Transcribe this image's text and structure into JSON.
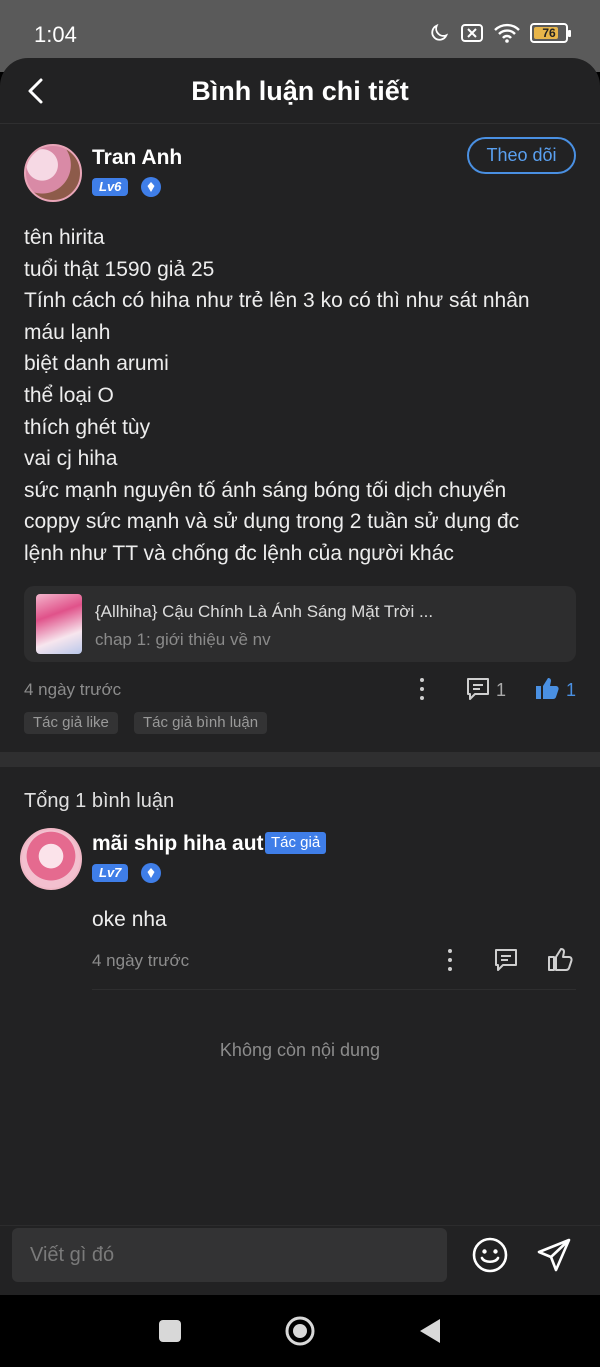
{
  "status_bar": {
    "time": "1:04",
    "battery": "76"
  },
  "header": {
    "title": "Bình luận chi tiết"
  },
  "post": {
    "username": "Tran Anh",
    "level": "Lv6",
    "follow_label": "Theo dõi",
    "lines": [
      "tên hirita",
      "tuổi thật 1590 giả 25",
      "Tính cách có hiha như trẻ lên 3 ko có thì như sát nhân",
      "máu lạnh",
      "biệt danh arumi",
      "thể loại O",
      "thích ghét tùy",
      "vai cj hiha",
      "sức mạnh nguyên tố ánh sáng bóng tối dịch chuyển",
      "coppy sức mạnh và sử dụng trong 2 tuần sử dụng đc",
      "lệnh như TT và chống đc lệnh của người khác"
    ],
    "story": {
      "title": "{Allhiha} Cậu Chính Là Ánh Sáng Mặt Trời ...",
      "chapter": "chap 1: giới thiệu về nv"
    },
    "time": "4 ngày trước",
    "comment_count": "1",
    "like_count": "1",
    "tags": [
      "Tác giả like",
      "Tác giả bình luận"
    ]
  },
  "replies": {
    "total_label": "Tổng 1 bình luận",
    "items": [
      {
        "username": "mãi ship hiha aut",
        "author_badge": "Tác giả",
        "level": "Lv7",
        "text": "oke nha",
        "time": "4 ngày trước"
      }
    ],
    "end_label": "Không còn nội dung"
  },
  "composer": {
    "placeholder": "Viết gì đó"
  },
  "colors": {
    "accent": "#3f7ee8",
    "follow": "#4a90e2",
    "background": "#222223"
  },
  "icons": [
    "back-icon",
    "moon-icon",
    "sim-icon",
    "wifi-icon",
    "battery-icon",
    "shield-icon",
    "more-icon",
    "comment-icon",
    "like-icon",
    "emoji-icon",
    "send-icon",
    "nav-square-icon",
    "nav-home-icon",
    "nav-back-icon"
  ]
}
